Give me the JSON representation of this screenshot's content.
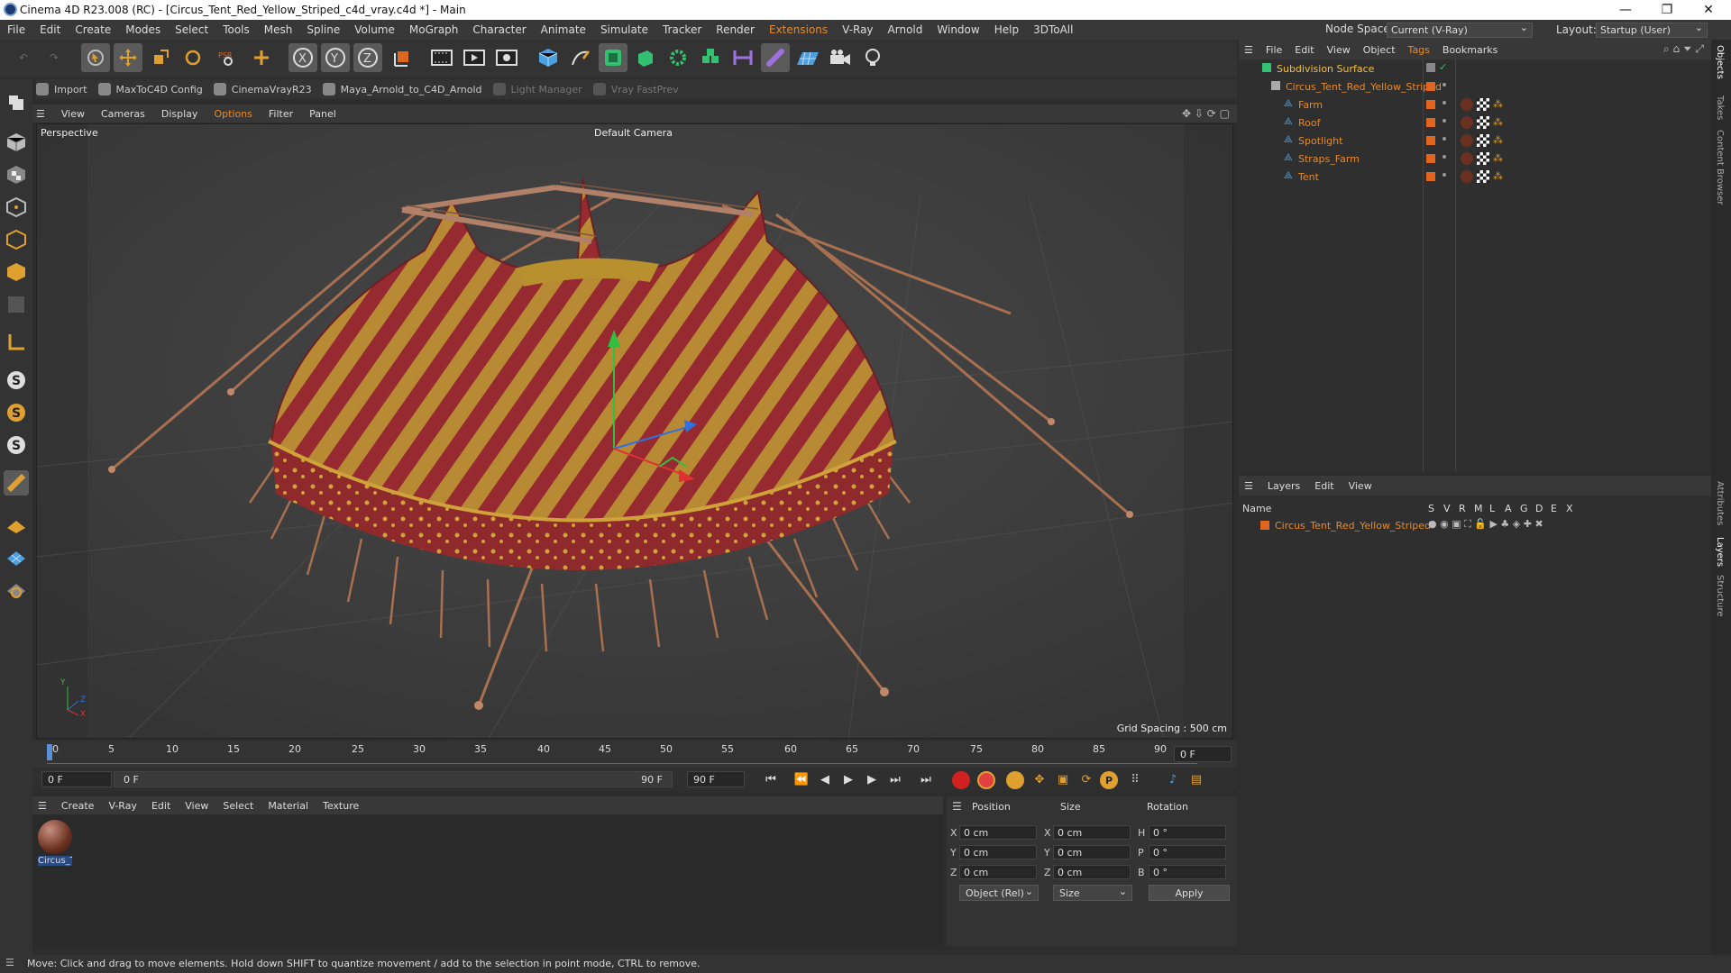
{
  "window": {
    "title": "Cinema 4D R23.008 (RC) - [Circus_Tent_Red_Yellow_Striped_c4d_vray.c4d *] - Main",
    "minimize": "—",
    "maximize": "❐",
    "close": "✕"
  },
  "menubar": {
    "items": [
      "File",
      "Edit",
      "Create",
      "Modes",
      "Select",
      "Tools",
      "Mesh",
      "Spline",
      "Volume",
      "MoGraph",
      "Character",
      "Animate",
      "Simulate",
      "Tracker",
      "Render",
      "Extensions",
      "V-Ray",
      "Arnold",
      "Window",
      "Help",
      "3DToAll"
    ],
    "node_space_label": "Node Space:",
    "node_space_value": "Current (V-Ray)",
    "layout_label": "Layout:",
    "layout_value": "Startup (User)"
  },
  "plugins": [
    {
      "label": "Import",
      "enabled": true
    },
    {
      "label": "MaxToC4D Config",
      "enabled": true
    },
    {
      "label": "CinemaVrayR23",
      "enabled": true
    },
    {
      "label": "Maya_Arnold_to_C4D_Arnold",
      "enabled": true
    },
    {
      "label": "Light Manager",
      "enabled": false
    },
    {
      "label": "Vray FastPrev",
      "enabled": false
    }
  ],
  "viewport": {
    "menu": [
      "View",
      "Cameras",
      "Display",
      "Options",
      "Filter",
      "Panel"
    ],
    "view_name": "Perspective",
    "camera": "Default Camera",
    "grid_spacing": "Grid Spacing : 500 cm",
    "axis_y": "Y",
    "axis_z": "Z",
    "axis_x": "X"
  },
  "timeline": {
    "ticks": [
      "0",
      "5",
      "10",
      "15",
      "20",
      "25",
      "30",
      "35",
      "40",
      "45",
      "50",
      "55",
      "60",
      "65",
      "70",
      "75",
      "80",
      "85",
      "90"
    ],
    "frame_end_display": "0 F",
    "current_frame": "0 F",
    "range_start": "0 F",
    "range_end": "90 F",
    "max_frame": "90 F"
  },
  "material_manager": {
    "menu": [
      "Create",
      "V-Ray",
      "Edit",
      "View",
      "Select",
      "Material",
      "Texture"
    ],
    "materials": [
      {
        "name": "Circus_Te"
      }
    ]
  },
  "attributes": {
    "headers": {
      "position": "Position",
      "size": "Size",
      "rotation": "Rotation"
    },
    "rows": [
      {
        "axis": "X",
        "pos": "0 cm",
        "size_axis": "X",
        "size": "0 cm",
        "rot_axis": "H",
        "rot": "0 °"
      },
      {
        "axis": "Y",
        "pos": "0 cm",
        "size_axis": "Y",
        "size": "0 cm",
        "rot_axis": "P",
        "rot": "0 °"
      },
      {
        "axis": "Z",
        "pos": "0 cm",
        "size_axis": "Z",
        "size": "0 cm",
        "rot_axis": "B",
        "rot": "0 °"
      }
    ],
    "coord_mode": "Object (Rel)",
    "size_mode": "Size",
    "apply": "Apply"
  },
  "object_manager": {
    "menu": [
      "File",
      "Edit",
      "View",
      "Object",
      "Tags",
      "Bookmarks"
    ],
    "objects": [
      {
        "name": "Subdivision Surface",
        "depth": 0
      },
      {
        "name": "Circus_Tent_Red_Yellow_Striped",
        "depth": 1
      },
      {
        "name": "Farm",
        "depth": 2
      },
      {
        "name": "Roof",
        "depth": 2
      },
      {
        "name": "Spotlight",
        "depth": 2
      },
      {
        "name": "Straps_Farm",
        "depth": 2
      },
      {
        "name": "Tent",
        "depth": 2
      }
    ]
  },
  "layer_manager": {
    "menu": [
      "Layers",
      "Edit",
      "View"
    ],
    "columns": [
      "Name",
      "S",
      "V",
      "R",
      "M",
      "L",
      "A",
      "G",
      "D",
      "E",
      "X"
    ],
    "layers": [
      {
        "name": "Circus_Tent_Red_Yellow_Striped",
        "color": "#e0651f"
      }
    ]
  },
  "side_tabs": [
    "Objects",
    "Takes",
    "Content Browser",
    "Attributes",
    "Layers",
    "Structure"
  ],
  "status": "Move: Click and drag to move elements. Hold down SHIFT to quantize movement / add to the selection in point mode, CTRL to remove.",
  "colors": {
    "accent": "#e58a2c",
    "tent_red": "#9a2a30",
    "tent_yellow": "#c9a23a"
  }
}
